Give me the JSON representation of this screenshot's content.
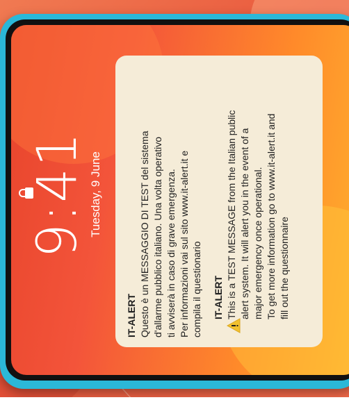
{
  "lockscreen": {
    "time": "9:41",
    "date": "Tuesday, 9 June"
  },
  "alerts": [
    {
      "title": "IT-ALERT",
      "body": "Questo è un MESSAGGIO DI TEST del sistema\nQuesto è un MESSAGGIO DI TEST del sistema"
    }
  ],
  "alert_it": {
    "title": "IT-ALERT",
    "body": "Questo è un MESSAGGIO DI TEST del sistema\nd'allarme pubblico italiano. Una volta operativo\nti avviserà in caso di grave emergenza.\nPer informazioni vai sul sito www.it-alert.it e\ncompila il questionario"
  },
  "alert_en": {
    "title": "IT-ALERT",
    "body": "This is a TEST MESSAGE from the Italian public\nalert system. It will alert you in the event of a\nmajor emergency once operational.\nTo get more information go to www.it-alert.it and\nfill out the questionnaire"
  },
  "colors": {
    "phone_frame": "#2bb8d8",
    "card_bg": "#f5ecd8",
    "warning_yellow": "#f2c12e"
  },
  "icons": {
    "lock": "lock-icon",
    "warning": "warning-icon"
  }
}
